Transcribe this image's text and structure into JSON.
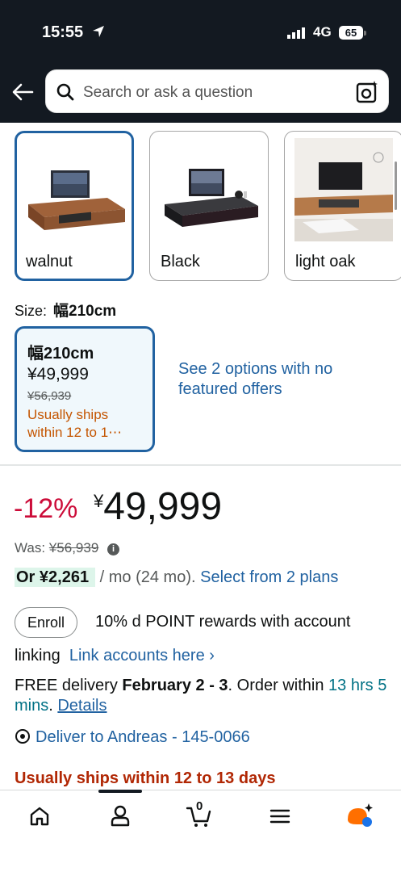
{
  "status_bar": {
    "time": "15:55",
    "network": "4G",
    "battery": "65"
  },
  "search": {
    "placeholder": "Search or ask a question"
  },
  "variants": [
    {
      "label": "walnut",
      "selected": true
    },
    {
      "label": "Black",
      "selected": false
    },
    {
      "label": "light oak",
      "selected": false
    }
  ],
  "size": {
    "label": "Size:",
    "value": "幅210cm",
    "card": {
      "title": "幅210cm",
      "price": "¥49,999",
      "was": "¥56,939",
      "ship_line1": "Usually ships",
      "ship_line2": "within 12 to 1⋯"
    },
    "see_options": "See 2 options with no featured offers"
  },
  "price": {
    "discount": "-12%",
    "currency": "¥",
    "amount": "49,999",
    "was_label": "Was:",
    "was_value": "¥56,939"
  },
  "installment": {
    "highlight": "Or ¥2,261",
    "middle": "/ mo (24 mo).",
    "link": "Select from 2 plans"
  },
  "points": {
    "enroll_label": "Enroll",
    "text": "10% d POINT rewards with account",
    "text2": "linking",
    "link": "Link accounts here ›"
  },
  "delivery": {
    "prefix": "FREE delivery",
    "dates": "February 2 - 3",
    "order_within": ". Order within",
    "countdown": "13 hrs 5 mins",
    "sep": ".",
    "details": "Details"
  },
  "deliver_to": "Deliver to Andreas -  145-0066",
  "ships_notice": "Usually ships within 12 to 13 days",
  "bottom_nav": {
    "items": [
      "home-icon",
      "account-icon",
      "cart-icon",
      "menu-icon",
      "rufus-icon"
    ],
    "cart_count": "0"
  },
  "colors": {
    "header_bg": "#131921",
    "link": "#2162a1",
    "discount_red": "#cc0c39",
    "shipping_orange": "#c45500",
    "alert_red": "#b12704",
    "teal": "#007185",
    "highlight_green": "#ddf5ea"
  }
}
